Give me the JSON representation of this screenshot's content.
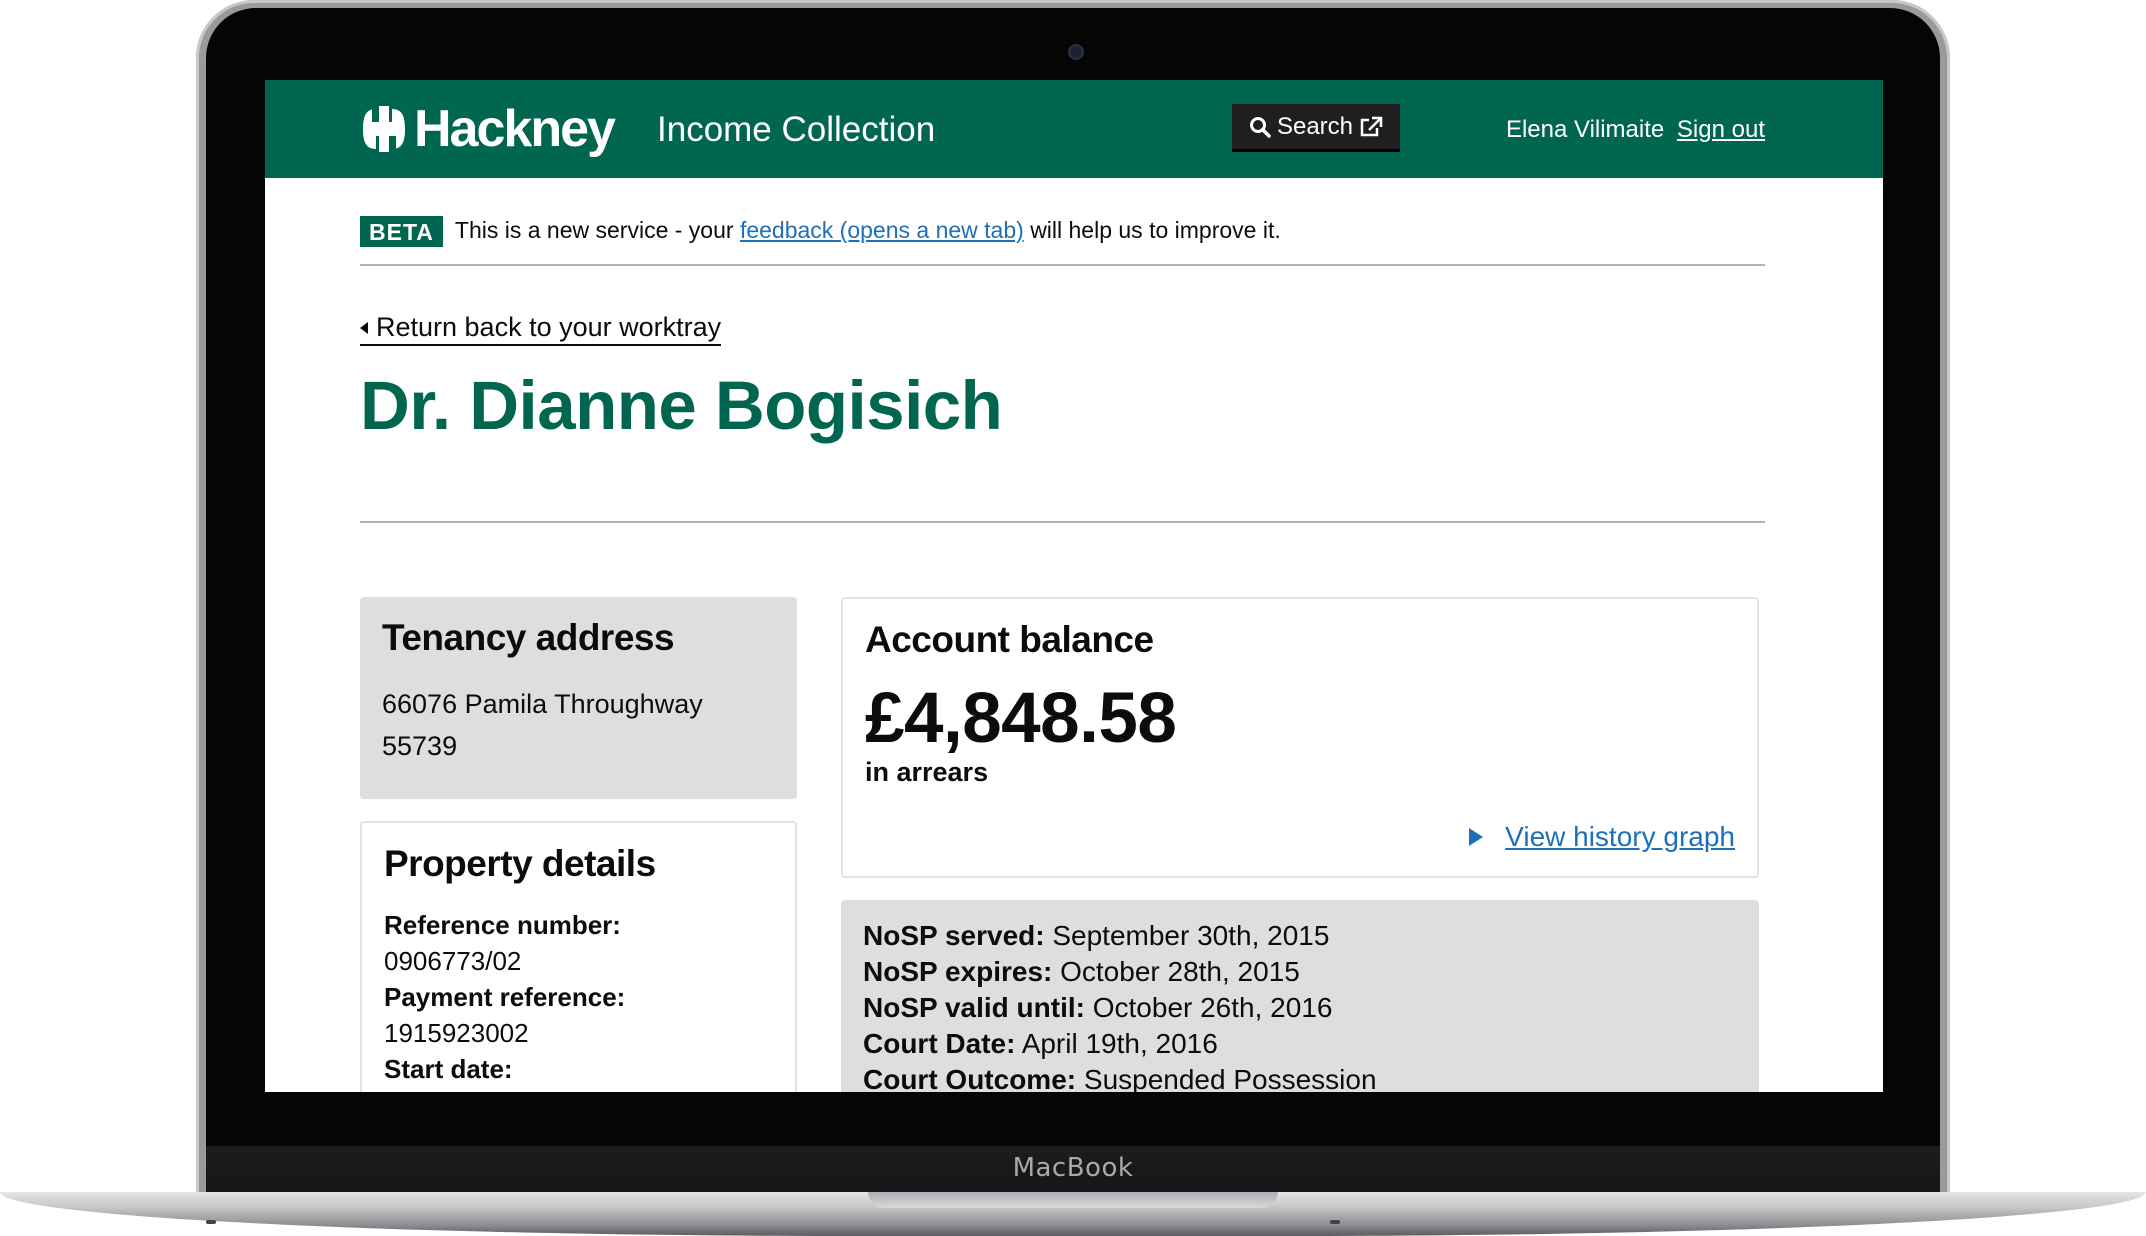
{
  "device": {
    "brand": "MacBook"
  },
  "header": {
    "logo_text": "Hackney",
    "service_name": "Income Collection",
    "search_label": "Search",
    "user_name": "Elena Vilimaite",
    "sign_out_label": "Sign out"
  },
  "beta_banner": {
    "tag": "BETA",
    "text_before": "This is a new service - your",
    "link_text": "feedback (opens a new tab)",
    "text_after": "will help us to improve it."
  },
  "back_link": "Return back to your worktray",
  "tenant_name": "Dr. Dianne Bogisich",
  "tenancy_address": {
    "title": "Tenancy address",
    "line1": "66076 Pamila Throughway",
    "line2": "55739"
  },
  "property_details": {
    "title": "Property details",
    "reference_label": "Reference number:",
    "reference_value": "0906773/02",
    "payment_label": "Payment reference:",
    "payment_value": "1915923002",
    "start_label": "Start date:"
  },
  "account_balance": {
    "title": "Account balance",
    "amount": "£4,848.58",
    "status": "in arrears",
    "history_link": "View history graph"
  },
  "nosp": {
    "served_label": "NoSP served:",
    "served_value": "September 30th, 2015",
    "expires_label": "NoSP expires:",
    "expires_value": "October 28th, 2015",
    "valid_label": "NoSP valid until:",
    "valid_value": "October 26th, 2016",
    "court_date_label": "Court Date:",
    "court_date_value": "April 19th, 2016",
    "court_outcome_label": "Court Outcome:",
    "court_outcome_value": "Suspended Possession"
  },
  "colors": {
    "brand_green": "#00664f",
    "link_blue": "#1d70b8",
    "panel_grey": "#dedede"
  }
}
